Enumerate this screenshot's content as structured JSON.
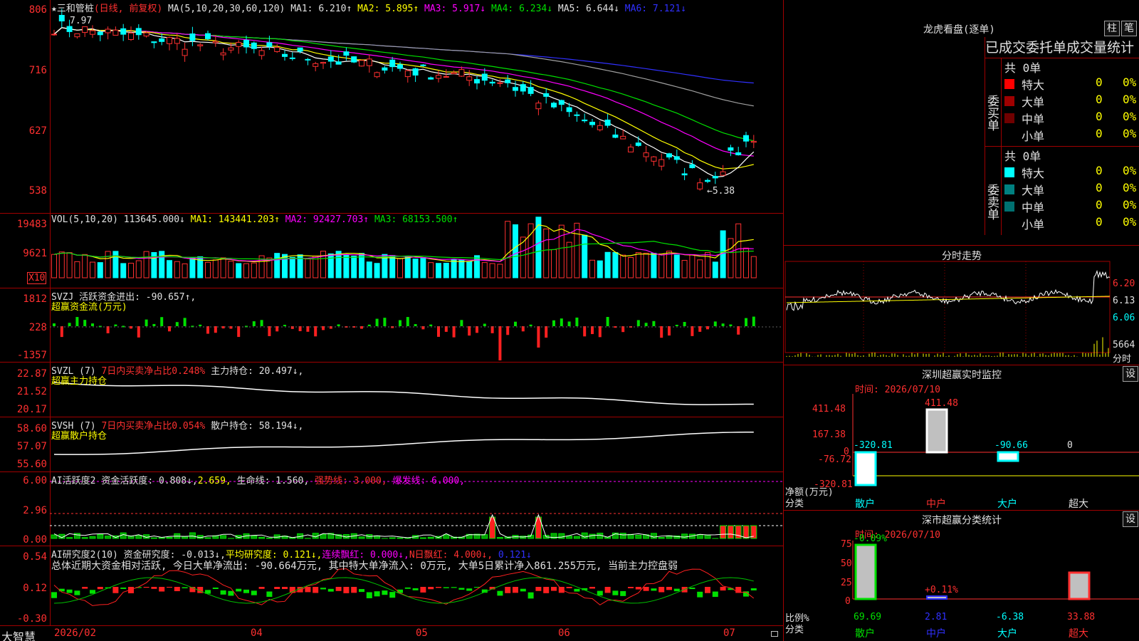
{
  "colors": {
    "up": "#ff3030",
    "down": "#00ffff",
    "ma1": "#ffffff",
    "ma2": "#ffff00",
    "ma3": "#ff00ff",
    "ma4": "#00e000",
    "ma5": "#a0a0a0",
    "ma6": "#3030ff",
    "grid": "#a00000"
  },
  "main": {
    "stock": "三和管桩",
    "mode": "(日线, 前复权)",
    "ma_label": "MA(5,10,20,30,60,120)",
    "ma1": "MA1: 6.210↑",
    "ma2": "MA2: 5.895↑",
    "ma3": "MA3: 5.917↓",
    "ma4": "MA4: 6.234↓",
    "ma5": "MA5: 6.644↓",
    "ma6": "MA6: 7.121↓",
    "yticks": [
      "806",
      "716",
      "627",
      "538"
    ],
    "high_mark": "7.97",
    "low_mark": "←5.38",
    "star": "★"
  },
  "vol": {
    "label": "VOL(5,10,20)",
    "value": "113645.000↓",
    "ma1": "MA1: 143441.203↑",
    "ma2": "MA2: 92427.703↑",
    "ma3": "MA3: 68153.500↑",
    "yticks": [
      "19483",
      "9621"
    ],
    "unit": "X10"
  },
  "svzj": {
    "label": "SVZJ",
    "title": "活跃资金进出: -90.657↑,",
    "sub": "超赢资金流(万元)",
    "yticks": [
      "1812",
      "228",
      "-1357"
    ]
  },
  "svzl": {
    "label": "SVZL (7)",
    "ratio": "7日内买卖净占比0.248%",
    "hold": "主力持仓: 20.497↓,",
    "sub": "超赢主力持仓",
    "yticks": [
      "22.87",
      "21.52",
      "20.17"
    ]
  },
  "svsh": {
    "label": "SVSH (7)",
    "ratio": "7日内买卖净占比0.054%",
    "hold": "散户持仓: 58.194↓,",
    "sub": "超赢散户持仓",
    "yticks": [
      "58.60",
      "57.07",
      "55.60"
    ]
  },
  "ai1": {
    "label": "AI活跃度2",
    "a": "资金活跃度: 0.808↓,",
    "b": "2.659,",
    "c": "生命线: 1.560,",
    "d": "强势线: 3.000,",
    "e": "爆发线: 6.000,",
    "yticks": [
      "6.00",
      "2.96",
      "0.00"
    ]
  },
  "ai2": {
    "label": "AI研究度2(10)",
    "a": "资金研究度: -0.013↓,",
    "b": "平均研究度: 0.121↓,",
    "c": "连续飘红: 0.000↓,",
    "d": "N日飘红: 4.000↓,",
    "e": "0.121↓",
    "summary": "总体近期大资金相对活跃, 今日大单净流出: -90.664万元, 其中特大单净流入: 0万元, 大单5日累计净入861.255万元, 当前主力控盘弱",
    "yticks": [
      "0.54",
      "0.12",
      "-0.30"
    ]
  },
  "footer": {
    "logo": "大智慧",
    "dates": [
      "2026/02",
      "04",
      "05",
      "06",
      "07"
    ]
  },
  "dragon": {
    "title": "龙虎看盘(逐单)",
    "btn1": "柱",
    "btn2": "笔",
    "header": "已成交委托单成交量统计",
    "buy_label": "委买单",
    "sell_label": "委卖单",
    "total": "共 0单",
    "rows": [
      {
        "n": "特大",
        "v": "0",
        "p": "0%"
      },
      {
        "n": "大单",
        "v": "0",
        "p": "0%"
      },
      {
        "n": "中单",
        "v": "0",
        "p": "0%"
      },
      {
        "n": "小单",
        "v": "0",
        "p": "0%"
      }
    ]
  },
  "intraday": {
    "title": "分时走势",
    "yticks": [
      "6.20",
      "6.13",
      "6.06"
    ],
    "vol": "5664",
    "vol_unit": "分时"
  },
  "monitor": {
    "title": "深圳超赢实时监控",
    "btn": "设",
    "time": "时间: 2026/07/10",
    "yticks": [
      "411.48",
      "167.38",
      "0",
      "-76.72",
      "-320.81"
    ],
    "labels": [
      "-320.81",
      "411.48",
      "-90.66",
      "0"
    ],
    "cats": [
      "散户",
      "中户",
      "大户",
      "超大"
    ],
    "axis1": "净额(万元)",
    "axis2": "分类"
  },
  "stats": {
    "title": "深市超赢分类统计",
    "btn": "设",
    "time": "时间: 2026/07/10",
    "yticks": [
      "75",
      "50",
      "25",
      "0"
    ],
    "top": [
      "-0.09%",
      "+0.11%"
    ],
    "labels": [
      "69.69",
      "2.81",
      "-6.38",
      "33.88"
    ],
    "cats": [
      "散户",
      "中户",
      "大户",
      "超大"
    ],
    "axis1": "比例%",
    "axis2": "分类"
  }
}
